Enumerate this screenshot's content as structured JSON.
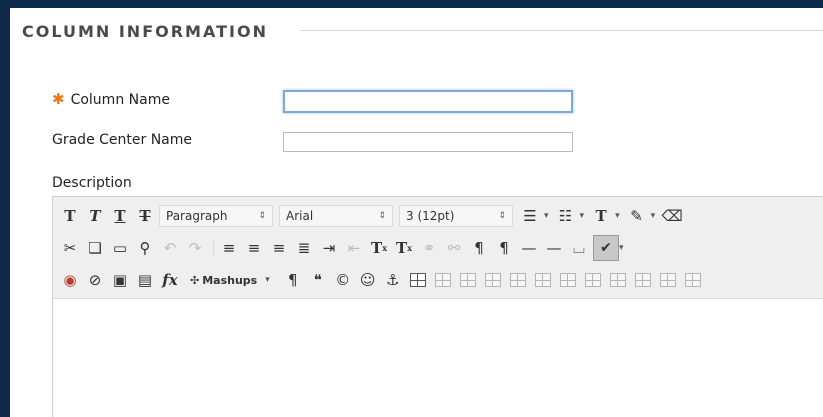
{
  "section": {
    "title": "COLUMN INFORMATION"
  },
  "fields": {
    "column_name": {
      "label": "Column Name",
      "required_mark": "✱",
      "value": ""
    },
    "grade_center_name": {
      "label": "Grade Center Name",
      "value": ""
    },
    "description": {
      "label": "Description"
    }
  },
  "toolbar": {
    "paragraph_format": "Paragraph",
    "font_family": "Arial",
    "font_size": "3 (12pt)",
    "mashups_label": "Mashups",
    "fx_label": "fx",
    "text_buttons": {
      "t1": "T",
      "t2": "T",
      "t3": "T",
      "t4": "T",
      "tcolor": "T",
      "sup": "T",
      "sub": "T"
    }
  },
  "colors": {
    "accent_focus": "#7ea7d8",
    "required_star": "#e87722",
    "frame": "#0d2a4a"
  }
}
